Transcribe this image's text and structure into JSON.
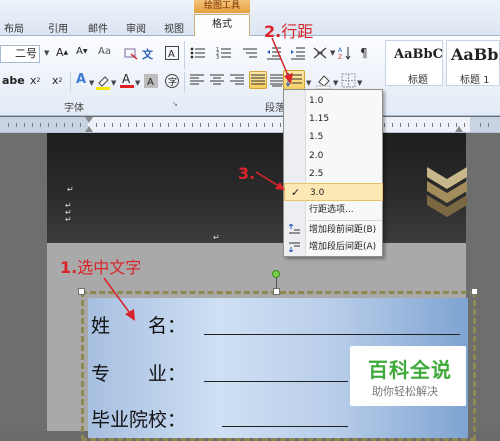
{
  "tabs": {
    "layout": "布局",
    "references": "引用",
    "mailings": "邮件",
    "review": "审阅",
    "view": "视图",
    "contextual_header": "绘图工具",
    "format": "格式"
  },
  "ribbon": {
    "font_size": "二号",
    "font_group_label": "字体",
    "paragraph_group_label": "段落",
    "styles": [
      {
        "sample": "AaBbC",
        "name": "标题"
      },
      {
        "sample": "AaBb",
        "name": "标题 1"
      }
    ]
  },
  "menu": {
    "items": [
      "1.0",
      "1.15",
      "1.5",
      "2.0",
      "2.5",
      "3.0"
    ],
    "checked_value": "3.0",
    "options_label": "行距选项...",
    "add_before": "增加段前间距(B)",
    "add_after": "增加段后间距(A)"
  },
  "document": {
    "fields": [
      "姓　　名：",
      "专　　业：",
      "毕业院校："
    ]
  },
  "annotations": {
    "step1_num": "1.",
    "step1_text": "选中文字",
    "step2_num": "2.",
    "step2_text": "行距",
    "step3_num": "3."
  },
  "watermark": {
    "title": "百科全说",
    "subtitle": "助你轻松解决"
  },
  "colors": {
    "annotation": "#d9242a",
    "watermark_green": "#3fa93a",
    "contextual_tab": "#e5a13e"
  }
}
